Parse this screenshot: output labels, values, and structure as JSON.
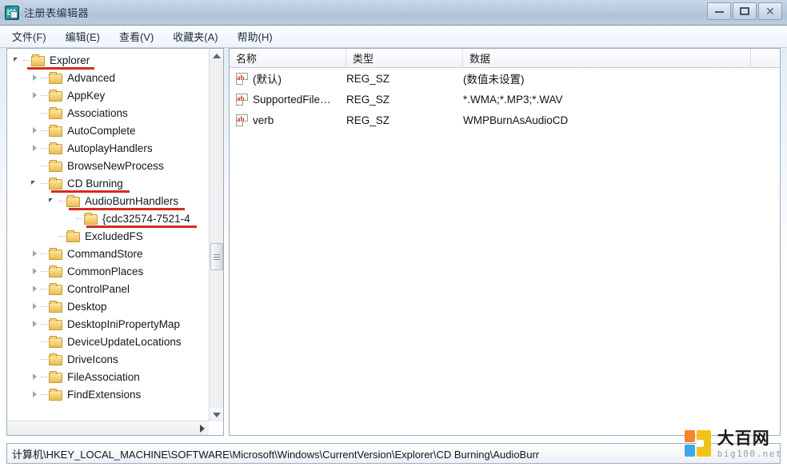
{
  "window": {
    "title": "注册表编辑器",
    "icon": "registry-editor-icon",
    "controls": {
      "minimize": "—",
      "maximize": "❐",
      "close": "✕"
    }
  },
  "menu": {
    "items": [
      {
        "label": "文件(F)"
      },
      {
        "label": "编辑(E)"
      },
      {
        "label": "查看(V)"
      },
      {
        "label": "收藏夹(A)"
      },
      {
        "label": "帮助(H)"
      }
    ]
  },
  "tree": {
    "nodes": [
      {
        "label": "Explorer",
        "indent": 0,
        "state": "expanded",
        "underline": true,
        "underline_style": "root"
      },
      {
        "label": "Advanced",
        "indent": 1,
        "state": "collapsed",
        "underline": false
      },
      {
        "label": "AppKey",
        "indent": 1,
        "state": "collapsed",
        "underline": false
      },
      {
        "label": "Associations",
        "indent": 1,
        "state": "leaf",
        "underline": false
      },
      {
        "label": "AutoComplete",
        "indent": 1,
        "state": "collapsed",
        "underline": false
      },
      {
        "label": "AutoplayHandlers",
        "indent": 1,
        "state": "collapsed",
        "underline": false
      },
      {
        "label": "BrowseNewProcess",
        "indent": 1,
        "state": "leaf",
        "underline": false
      },
      {
        "label": "CD Burning",
        "indent": 1,
        "state": "expanded",
        "underline": true,
        "underline_style": "normal"
      },
      {
        "label": "AudioBurnHandlers",
        "indent": 2,
        "state": "expanded",
        "underline": true,
        "underline_style": "normal"
      },
      {
        "label": "{cdc32574-7521-4",
        "indent": 3,
        "state": "leaf",
        "underline": true,
        "underline_style": "normal"
      },
      {
        "label": "ExcludedFS",
        "indent": 2,
        "state": "leaf",
        "underline": false
      },
      {
        "label": "CommandStore",
        "indent": 1,
        "state": "collapsed",
        "underline": false
      },
      {
        "label": "CommonPlaces",
        "indent": 1,
        "state": "collapsed",
        "underline": false
      },
      {
        "label": "ControlPanel",
        "indent": 1,
        "state": "collapsed",
        "underline": false
      },
      {
        "label": "Desktop",
        "indent": 1,
        "state": "collapsed",
        "underline": false
      },
      {
        "label": "DesktopIniPropertyMap",
        "indent": 1,
        "state": "collapsed",
        "underline": false
      },
      {
        "label": "DeviceUpdateLocations",
        "indent": 1,
        "state": "leaf",
        "underline": false
      },
      {
        "label": "DriveIcons",
        "indent": 1,
        "state": "leaf",
        "underline": false
      },
      {
        "label": "FileAssociation",
        "indent": 1,
        "state": "collapsed",
        "underline": false
      },
      {
        "label": "FindExtensions",
        "indent": 1,
        "state": "collapsed",
        "underline": false
      }
    ],
    "highlight_color": "#d22b22"
  },
  "list": {
    "columns": [
      {
        "label": "名称"
      },
      {
        "label": "类型"
      },
      {
        "label": "数据"
      }
    ],
    "rows": [
      {
        "icon": "string-value-icon",
        "name": "(默认)",
        "type": "REG_SZ",
        "data": "(数值未设置)"
      },
      {
        "icon": "string-value-icon",
        "name": "SupportedFile…",
        "type": "REG_SZ",
        "data": "*.WMA;*.MP3;*.WAV"
      },
      {
        "icon": "string-value-icon",
        "name": "verb",
        "type": "REG_SZ",
        "data": "WMPBurnAsAudioCD"
      }
    ]
  },
  "status": {
    "path": "计算机\\HKEY_LOCAL_MACHINE\\SOFTWARE\\Microsoft\\Windows\\CurrentVersion\\Explorer\\CD Burning\\AudioBurr"
  },
  "watermark": {
    "name_cn": "大百网",
    "name_en": "big100.net"
  }
}
